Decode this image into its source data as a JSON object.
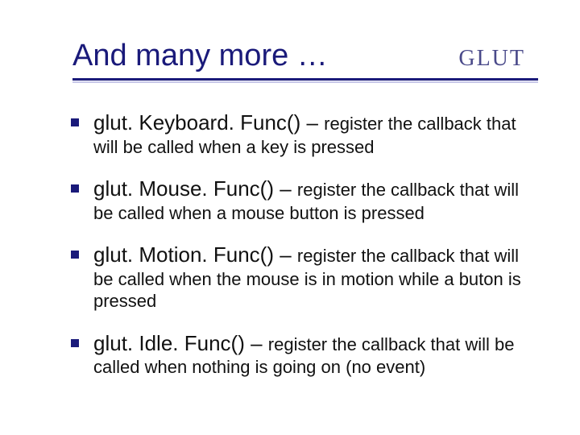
{
  "header": {
    "title": "And many more …",
    "tag": "GLUT"
  },
  "items": [
    {
      "func": "glut. Keyboard. Func() – ",
      "desc": "register the callback that will be called when a key is pressed"
    },
    {
      "func": "glut. Mouse. Func() – ",
      "desc": "register the callback that will be called when a mouse button is pressed"
    },
    {
      "func": "glut. Motion. Func() – ",
      "desc": "register the callback that will be called when the mouse is in motion while a buton is pressed"
    },
    {
      "func": "glut. Idle. Func() – ",
      "desc": "register the callback that will be called when nothing is going on (no event)"
    }
  ]
}
